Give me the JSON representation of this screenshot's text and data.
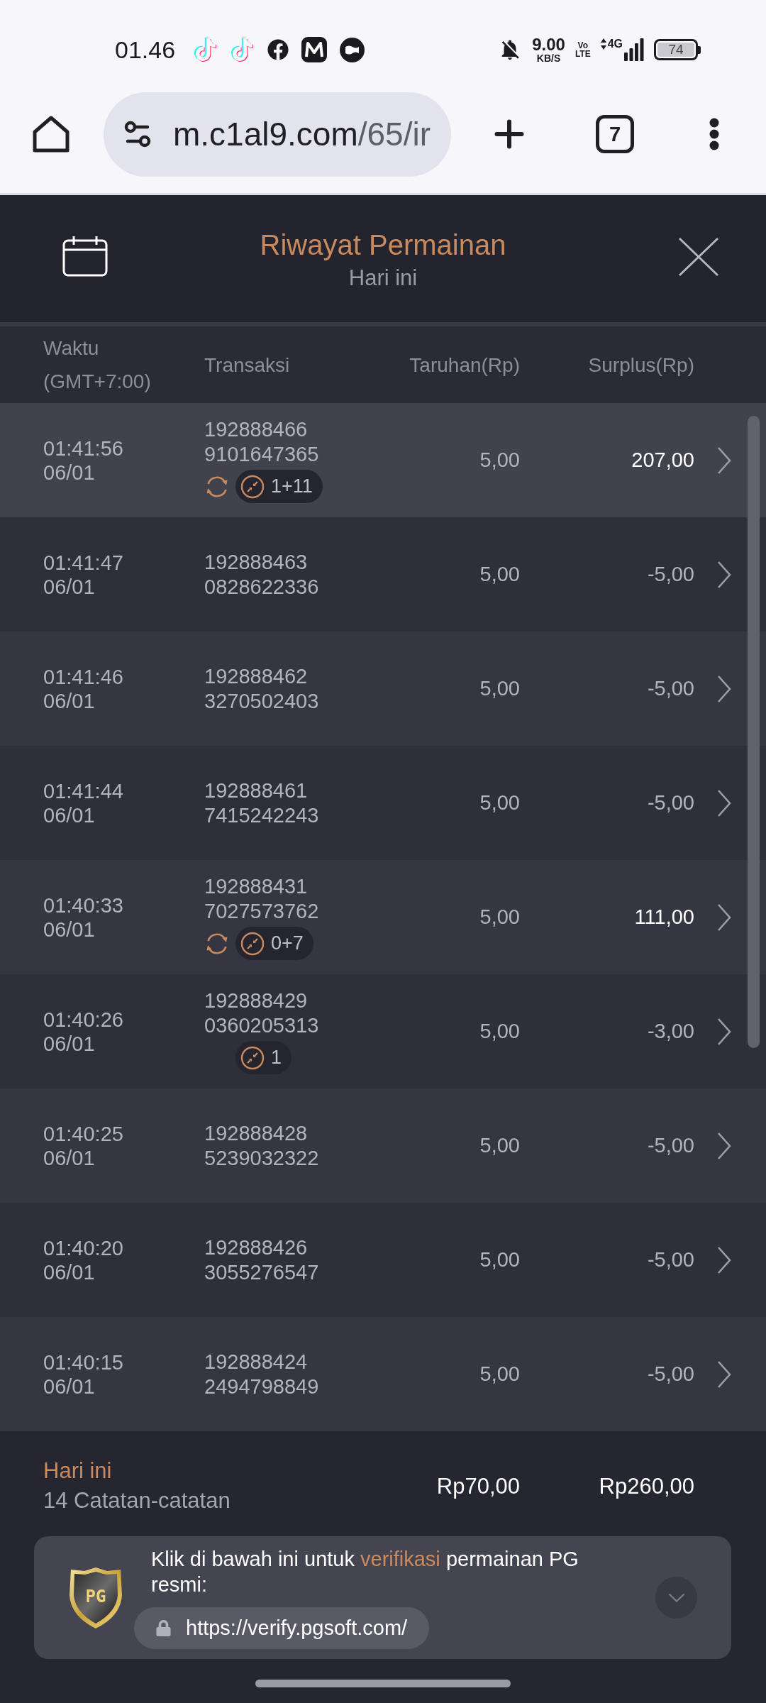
{
  "status_bar": {
    "time": "01.46",
    "net_speed": "9.00",
    "net_speed_unit": "KB/S",
    "volte": [
      "Vo",
      "LTE"
    ],
    "network": "4G",
    "battery": "74"
  },
  "browser": {
    "url_host": "m.c1al9.com",
    "url_path": "/65/ir",
    "tab_count": "7"
  },
  "header": {
    "title": "Riwayat Permainan",
    "subtitle": "Hari ini"
  },
  "columns": [
    "Waktu (GMT+7:00)",
    "Transaksi",
    "Taruhan(Rp)",
    "Surplus(Rp)"
  ],
  "rows": [
    {
      "time": "01:41:56",
      "date": "06/01",
      "transaction": [
        "192888466",
        "9101647365"
      ],
      "respin": true,
      "free_spins": "1+11",
      "bet": "5,00",
      "surplus": "207,00",
      "won": true,
      "selected": true
    },
    {
      "time": "01:41:47",
      "date": "06/01",
      "transaction": [
        "192888463",
        "0828622336"
      ],
      "respin": false,
      "bet": "5,00",
      "surplus": "-5,00",
      "won": false,
      "selected": false
    },
    {
      "time": "01:41:46",
      "date": "06/01",
      "transaction": [
        "192888462",
        "3270502403"
      ],
      "respin": false,
      "bet": "5,00",
      "surplus": "-5,00",
      "won": false,
      "selected": false
    },
    {
      "time": "01:41:44",
      "date": "06/01",
      "transaction": [
        "192888461",
        "7415242243"
      ],
      "respin": false,
      "bet": "5,00",
      "surplus": "-5,00",
      "won": false,
      "selected": false
    },
    {
      "time": "01:40:33",
      "date": "06/01",
      "transaction": [
        "192888431",
        "7027573762"
      ],
      "respin": true,
      "free_spins": "0+7",
      "bet": "5,00",
      "surplus": "111,00",
      "won": true,
      "selected": false
    },
    {
      "time": "01:40:26",
      "date": "06/01",
      "transaction": [
        "192888429",
        "0360205313"
      ],
      "respin": false,
      "free_spins": "1",
      "bet": "5,00",
      "surplus": "-3,00",
      "won": false,
      "selected": false
    },
    {
      "time": "01:40:25",
      "date": "06/01",
      "transaction": [
        "192888428",
        "5239032322"
      ],
      "respin": false,
      "bet": "5,00",
      "surplus": "-5,00",
      "won": false,
      "selected": false
    },
    {
      "time": "01:40:20",
      "date": "06/01",
      "transaction": [
        "192888426",
        "3055276547"
      ],
      "respin": false,
      "bet": "5,00",
      "surplus": "-5,00",
      "won": false,
      "selected": false
    },
    {
      "time": "01:40:15",
      "date": "06/01",
      "transaction": [
        "192888424",
        "2494798849"
      ],
      "respin": false,
      "bet": "5,00",
      "surplus": "-5,00",
      "won": false,
      "selected": false
    }
  ],
  "summary": {
    "label": "Hari ini",
    "count": "14 Catatan-catatan",
    "total_bet": "Rp70,00",
    "total_surplus": "Rp260,00"
  },
  "verify": {
    "logo": "PG",
    "text_before": "Klik di bawah ini untuk",
    "highlight": "verifikasi",
    "text_after": "permainan PG resmi:",
    "url": "https://verify.pgsoft.com/"
  }
}
